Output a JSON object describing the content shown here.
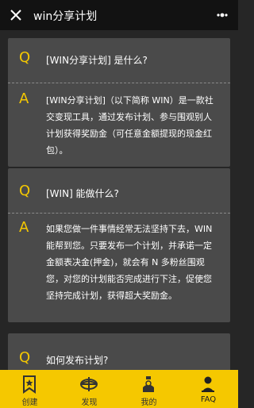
{
  "header": {
    "title": "win分享计划"
  },
  "faq": [
    {
      "q_letter": "Q",
      "question": "[WIN分享计划] 是什么?",
      "a_letter": "A",
      "answer": "[WIN分享计划]（以下简称 WIN）是一款社交变现工具，通过发布计划、参与围观别人计划获得奖励金（可任意金额提现的现金红包）。"
    },
    {
      "q_letter": "Q",
      "question": "[WIN] 能做什么?",
      "a_letter": "A",
      "answer": "如果您做一件事情经常无法坚持下去，WIN 能帮到您。只要发布一个计划，并承诺一定金额表决金(押金)，就会有 N 多粉丝围观您，对您的计划能否完成进行下注，促使您坚持完成计划，获得超大奖励金。"
    },
    {
      "q_letter": "Q",
      "question": "如何发布计划?"
    }
  ],
  "tabs": [
    {
      "label": "创建",
      "icon": "create-icon"
    },
    {
      "label": "发现",
      "icon": "discover-icon"
    },
    {
      "label": "我的",
      "icon": "mine-icon"
    },
    {
      "label": "FAQ",
      "icon": "faq-icon"
    }
  ],
  "colors": {
    "accent": "#f5c800",
    "card": "#4a4a4a",
    "background": "#262626",
    "topbar": "#121212"
  }
}
